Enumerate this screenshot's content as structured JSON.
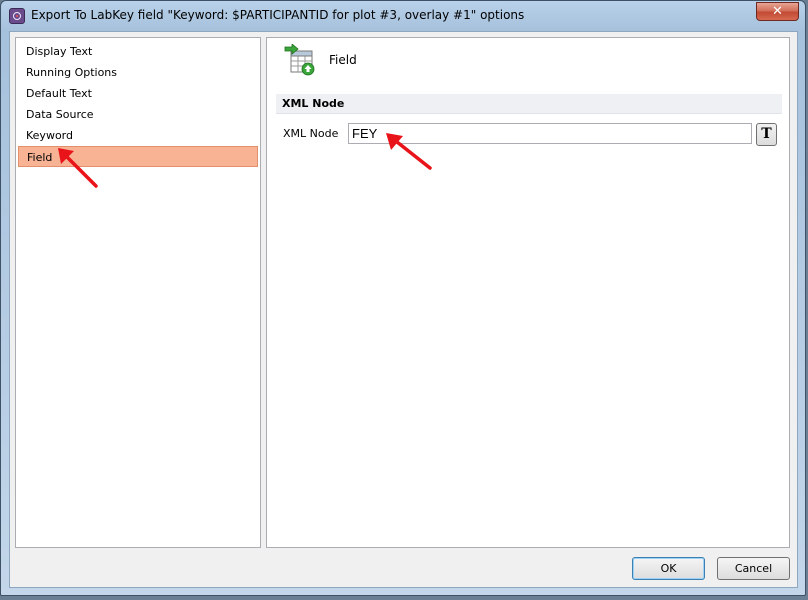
{
  "window": {
    "title": "Export To LabKey field \"Keyword: $PARTICIPANTID for plot #3, overlay #1\" options",
    "close_glyph": "✕"
  },
  "sidebar": {
    "items": [
      {
        "label": "Display Text"
      },
      {
        "label": "Running Options"
      },
      {
        "label": "Default Text"
      },
      {
        "label": "Data Source"
      },
      {
        "label": "Keyword"
      },
      {
        "label": "Field",
        "selected": true
      }
    ]
  },
  "main": {
    "section_title": "Field",
    "group_header": "XML Node",
    "xml_node_label": "XML Node",
    "xml_node_value": "FEY",
    "text_format_button": "T"
  },
  "footer": {
    "ok_label": "OK",
    "cancel_label": "Cancel"
  },
  "colors": {
    "selection": "#f8b395",
    "annotation_arrow": "#e8141a"
  },
  "icons": {
    "app": "flowjo-app-icon",
    "field": "table-field-add-icon",
    "annotation": "red-arrow-annotation"
  }
}
